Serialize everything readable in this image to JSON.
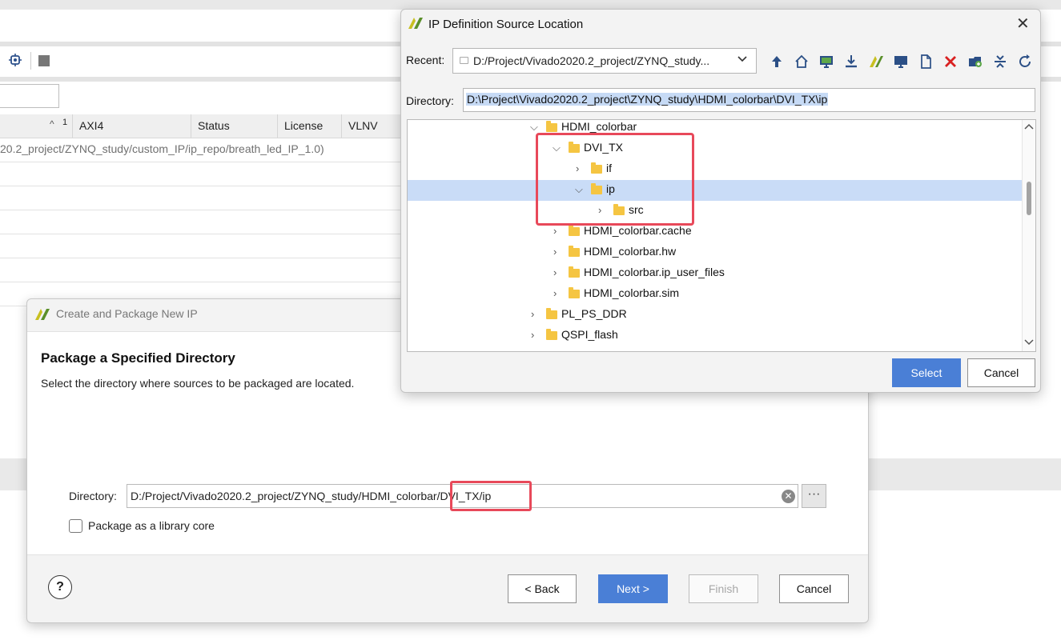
{
  "background": {
    "table_headers": [
      "1",
      "AXI4",
      "Status",
      "License",
      "VLNV"
    ],
    "first_row_text": "20.2_project/ZYNQ_study/custom_IP/ip_repo/breath_led_IP_1.0)"
  },
  "package_dialog": {
    "title": "Create and Package New IP",
    "heading": "Package a Specified Directory",
    "description": "Select the directory where sources to be packaged are located.",
    "directory_label": "Directory:",
    "directory_value": "D:/Project/Vivado2020.2_project/ZYNQ_study/HDMI_colorbar/DVI_TX/ip",
    "browse_label": "···",
    "library_core_label": "Package as a library core",
    "library_core_checked": false,
    "help_label": "?",
    "back_label": "< Back",
    "next_label": "Next >",
    "finish_label": "Finish",
    "cancel_label": "Cancel"
  },
  "ip_dialog": {
    "title": "IP Definition Source Location",
    "close_label": "✕",
    "recent_label": "Recent:",
    "recent_value": "D:/Project/Vivado2020.2_project/ZYNQ_study...",
    "directory_label": "Directory:",
    "directory_value": "D:\\Project\\Vivado2020.2_project\\ZYNQ_study\\HDMI_colorbar\\DVI_TX\\ip",
    "toolbar_icons": [
      "up-arrow-icon",
      "home-icon",
      "desktop-icon",
      "download-icon",
      "vivado-icon",
      "monitor-icon",
      "file-icon",
      "delete-icon",
      "new-folder-icon",
      "collapse-icon",
      "refresh-icon"
    ],
    "tree": [
      {
        "label": "HDMI_colorbar",
        "expanded": true
      },
      {
        "label": "DVI_TX",
        "expanded": true
      },
      {
        "label": "if",
        "expanded": false
      },
      {
        "label": "ip",
        "expanded": true,
        "selected": true
      },
      {
        "label": "src",
        "expanded": false
      },
      {
        "label": "HDMI_colorbar.cache",
        "expanded": false
      },
      {
        "label": "HDMI_colorbar.hw",
        "expanded": false
      },
      {
        "label": "HDMI_colorbar.ip_user_files",
        "expanded": false
      },
      {
        "label": "HDMI_colorbar.sim",
        "expanded": false
      },
      {
        "label": "PL_PS_DDR",
        "expanded": false
      },
      {
        "label": "QSPI_flash",
        "expanded": false
      }
    ],
    "select_label": "Select",
    "cancel_label": "Cancel"
  },
  "colors": {
    "primary_button": "#4a7fd6",
    "selection": "#c9dcf7",
    "highlight_box": "#e8495a",
    "folder": "#f5c542"
  }
}
